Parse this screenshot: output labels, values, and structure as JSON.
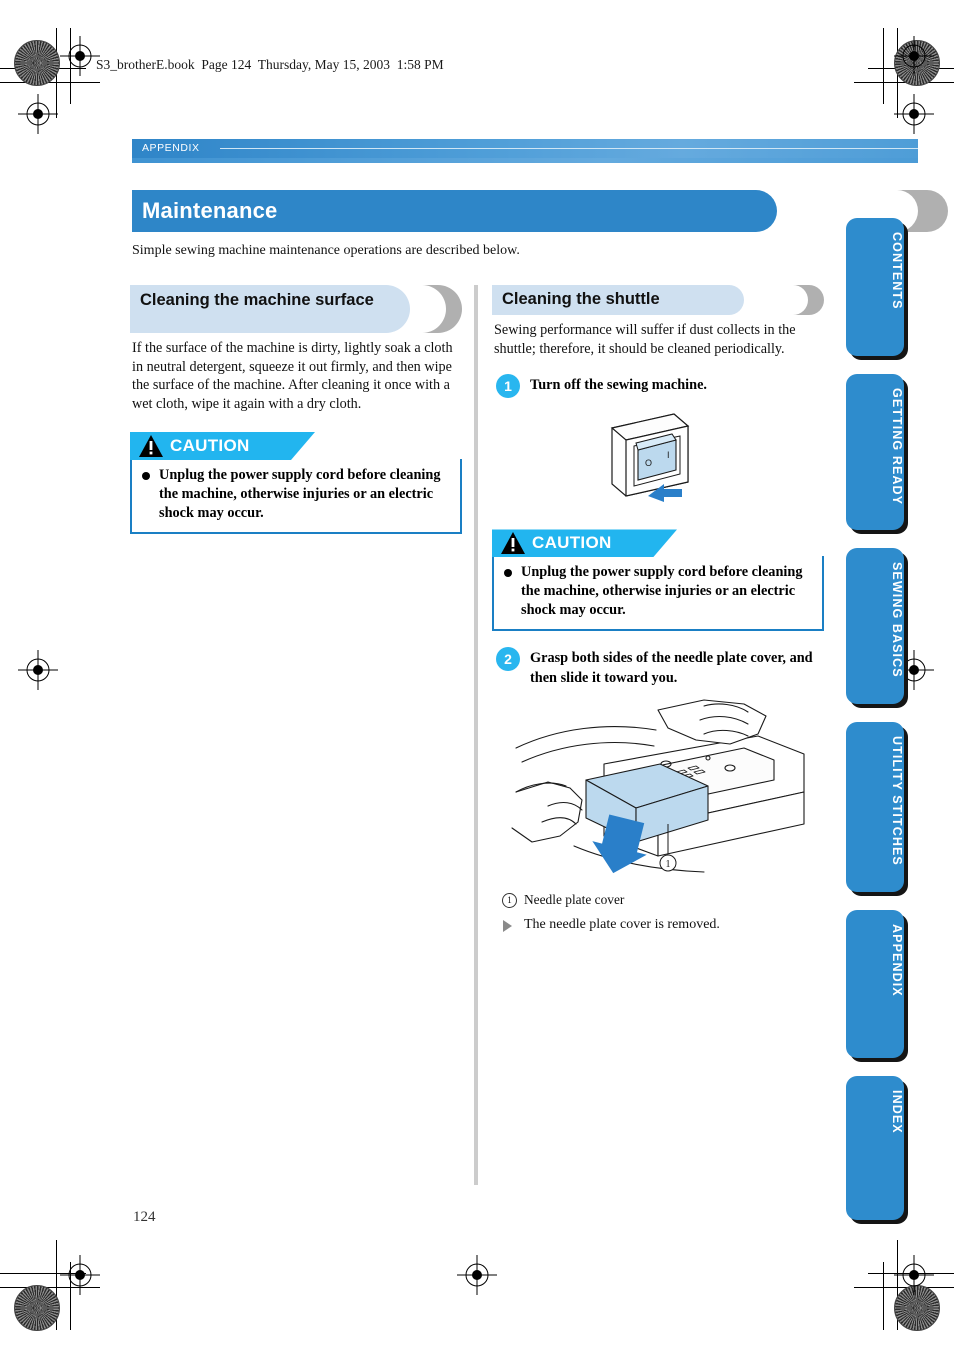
{
  "running_head": "S3_brotherE.book  Page 124  Thursday, May 15, 2003  1:58 PM",
  "chapter_bar": {
    "label": "APPENDIX"
  },
  "title": {
    "text": "Maintenance"
  },
  "lead_text": "Simple sewing machine maintenance operations are described below.",
  "left_column": {
    "heading": "Cleaning the machine surface",
    "body": "If the surface of the machine is dirty, lightly soak a cloth in neutral detergent, squeeze it out firmly, and then wipe the surface of the machine. After cleaning it once with a wet cloth, wipe it again with a dry cloth.",
    "caution": {
      "label": "CAUTION",
      "items": [
        "Unplug the power supply cord before cleaning the machine, otherwise injuries or an electric shock may occur."
      ]
    }
  },
  "right_column": {
    "heading": "Cleaning the shuttle",
    "body": "Sewing performance will suffer if dust collects in the shuttle; therefore, it should be cleaned periodically.",
    "step1": {
      "number": "1",
      "text": "Turn off the sewing machine."
    },
    "figure1": {
      "name": "power-switch-illustration",
      "marks": [
        "O",
        "I"
      ]
    },
    "caution": {
      "label": "CAUTION",
      "items": [
        "Unplug the power supply cord before cleaning the machine, otherwise injuries or an electric shock may occur."
      ]
    },
    "step2": {
      "number": "2",
      "text": "Grasp both sides of the needle plate cover, and then slide it toward you."
    },
    "figure2": {
      "name": "needle-plate-cover-illustration",
      "callout": "1"
    },
    "caption": {
      "num": "1",
      "text": "Needle plate cover"
    },
    "result": "The needle plate cover is removed."
  },
  "side_tabs": [
    {
      "label": "CONTENTS"
    },
    {
      "label": "GETTING READY"
    },
    {
      "label": "SEWING BASICS"
    },
    {
      "label": "UTILITY STITCHES"
    },
    {
      "label": "APPENDIX"
    },
    {
      "label": "INDEX"
    }
  ],
  "page_number": "124",
  "colors": {
    "brand_blue": "#2e86c8",
    "tab_blue": "#2e8ccd",
    "caution_cyan": "#22b5ef",
    "caution_border": "#1a7fc4",
    "subhead_blue": "#cfe0f0",
    "echo_gray": "#b0b0b0",
    "illustration_fill": "#bcd9ee"
  }
}
